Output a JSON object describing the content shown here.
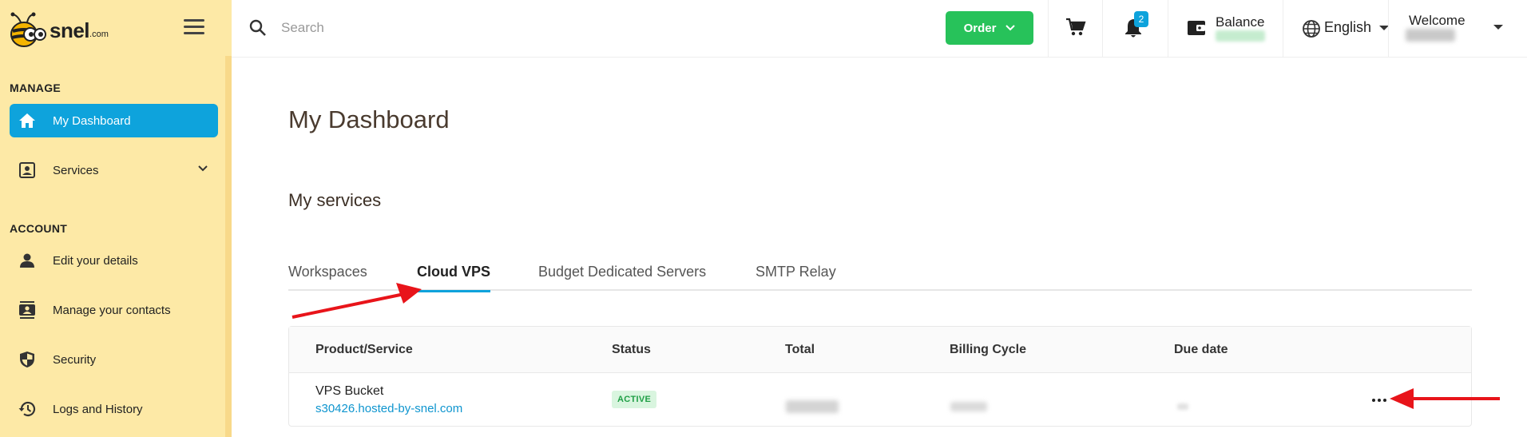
{
  "brand": {
    "name": "snel",
    "suffix": ".com"
  },
  "search": {
    "placeholder": "Search"
  },
  "header": {
    "order_label": "Order",
    "notification_count": "2",
    "balance_label": "Balance",
    "language": "English",
    "welcome_label": "Welcome"
  },
  "sidebar": {
    "manage_label": "MANAGE",
    "account_label": "ACCOUNT",
    "manage_items": [
      {
        "label": "My Dashboard",
        "icon": "home-icon",
        "active": true
      },
      {
        "label": "Services",
        "icon": "services-icon",
        "has_submenu": true
      }
    ],
    "account_items": [
      {
        "label": "Edit your details",
        "icon": "person-icon"
      },
      {
        "label": "Manage your contacts",
        "icon": "contacts-icon"
      },
      {
        "label": "Security",
        "icon": "shield-icon"
      },
      {
        "label": "Logs and History",
        "icon": "history-icon"
      }
    ]
  },
  "main": {
    "page_title": "My Dashboard",
    "services_title": "My services",
    "tabs": [
      {
        "label": "Workspaces"
      },
      {
        "label": "Cloud VPS",
        "active": true
      },
      {
        "label": "Budget Dedicated Servers"
      },
      {
        "label": "SMTP Relay"
      }
    ],
    "table": {
      "columns": [
        "Product/Service",
        "Status",
        "Total",
        "Billing Cycle",
        "Due date"
      ],
      "rows": [
        {
          "product": "VPS Bucket",
          "host": "s30426.hosted-by-snel.com",
          "status": "ACTIVE"
        }
      ]
    }
  },
  "colors": {
    "sidebar_bg": "#fde9a6",
    "accent": "#0ea3dc",
    "order_green": "#27c25a",
    "annotation_red": "#e8141a"
  }
}
